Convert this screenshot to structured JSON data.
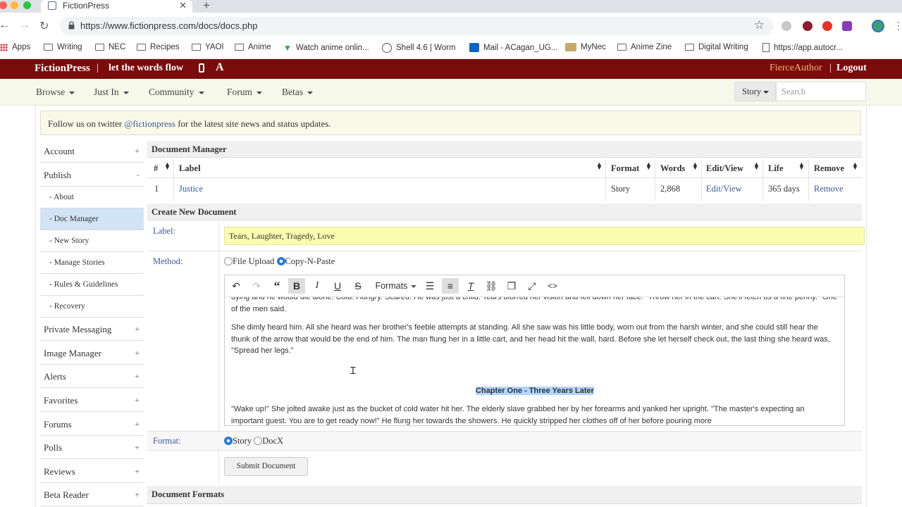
{
  "browser": {
    "tab_title": "FictionPress",
    "url": "https://www.fictionpress.com/docs/docs.php",
    "bookmarks": [
      "Apps",
      "Writing",
      "NEC",
      "Recipes",
      "YAOI",
      "Anime",
      "Watch anime onlin...",
      "Shell 4.6 | Worm",
      "Mail - ACagan_UG...",
      "MyNec",
      "Anime Zine",
      "Digital Writing",
      "https://app.autocr..."
    ]
  },
  "site": {
    "logo": "FictionPress",
    "separator": "|",
    "tagline": "let the words flow",
    "a_icon": "A",
    "user": "FierceAuthor",
    "user_sep": "|",
    "logout": "Logout",
    "nav": [
      "Browse",
      "Just In",
      "Community",
      "Forum",
      "Betas"
    ],
    "story_select": "Story",
    "search_placeholder": "Search",
    "twitter_pre": "Follow us on twitter ",
    "twitter_handle": "@fictionpress",
    "twitter_post": " for the latest site news and status updates."
  },
  "sidebar": {
    "account": "Account",
    "publish": "Publish",
    "sub": [
      "- About",
      "- Doc Manager",
      "- New Story",
      "- Manage Stories",
      "- Rules & Guidelines",
      "- Recovery"
    ],
    "items": [
      "Private Messaging",
      "Image Manager",
      "Alerts",
      "Favorites",
      "Forums",
      "Polls",
      "Reviews",
      "Beta Reader"
    ],
    "plus": "+",
    "minus": "-"
  },
  "doc_manager": {
    "title": "Document Manager",
    "headers": [
      "#",
      "Label",
      "Format",
      "Words",
      "Edit/View",
      "Life",
      "Remove"
    ],
    "row": {
      "num": "1",
      "label": "Justice",
      "format": "Story",
      "words": "2,868",
      "edit": "Edit/View",
      "life": "365 days",
      "remove": "Remove"
    }
  },
  "create": {
    "title": "Create New Document",
    "label_field": "Label:",
    "label_value": "Tears, Laughter, Tragedy, Love",
    "method_field": "Method:",
    "method_upload": "File Upload",
    "method_paste": "Copy-N-Paste",
    "formats_menu": "Formats",
    "format_field": "Format:",
    "format_story": "Story",
    "format_docx": "DocX",
    "submit": "Submit Document",
    "doc_formats": "Document Formats",
    "editor": {
      "p0": "dying and he would die alone. Cold. Hungry. Scared. He was just a child. Tears blurred her vision and fell down her face. \"Throw her in the cart. She'll fetch us a fine penny.\" One of the men said.",
      "p1": "She dimly heard him. All she heard was her brother's feeble attempts at standing. All she saw was his little body, worn out from the harsh winter, and she could still hear the thunk of the arrow that would be the end of him. The man flung her in a little cart, and her head hit the wall, hard. Before she let herself check out, the last thing she heard was, \"Spread her legs.\"",
      "chapter": "Chapter One - Three Years Later",
      "p2": "\"Wake up!\" She jolted awake just as the bucket of cold water hit her. The elderly slave grabbed her by her forearms and yanked her upright. \"The master's expecting an important guest. You are to get ready now!\" He flung her towards the showers. He quickly stripped her clothes off of her before pouring more"
    }
  }
}
